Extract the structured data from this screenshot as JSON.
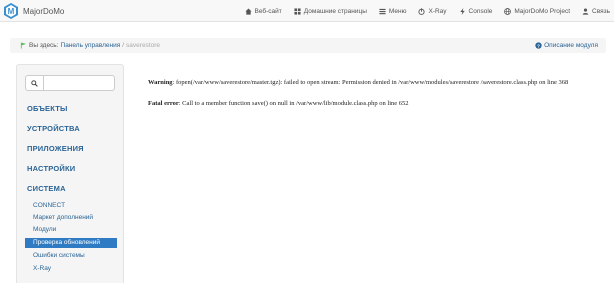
{
  "navbar": {
    "brand": "MajorDoMo",
    "items": [
      {
        "label": "Веб-сайт",
        "icon": "home-icon"
      },
      {
        "label": "Домашние страницы",
        "icon": "grid-icon"
      },
      {
        "label": "Меню",
        "icon": "list-icon"
      },
      {
        "label": "X-Ray",
        "icon": "power-icon"
      },
      {
        "label": "Console",
        "icon": "flash-icon"
      },
      {
        "label": "MajorDoMo Project",
        "icon": "globe-icon"
      },
      {
        "label": "Связь",
        "icon": "user-icon"
      }
    ]
  },
  "breadcrumb": {
    "home": "Вы здесь:",
    "link": "Панель управления",
    "separator": "/",
    "current": "saverestore",
    "help": "Описание модуля"
  },
  "sidebar": {
    "search_placeholder": "",
    "sections": [
      "ОБЪЕКТЫ",
      "УСТРОЙСТВА",
      "ПРИЛОЖЕНИЯ",
      "НАСТРОЙКИ",
      "СИСТЕМА"
    ],
    "sub_items": [
      {
        "label": "CONNECT",
        "active": false
      },
      {
        "label": "Маркет дополнений",
        "active": false
      },
      {
        "label": "Модули",
        "active": false
      },
      {
        "label": "Проверка обновлений",
        "active": true
      },
      {
        "label": "Ошибки системы",
        "active": false
      },
      {
        "label": "X-Ray",
        "active": false
      }
    ]
  },
  "content": {
    "warning_label": "Warning",
    "warning_text": ": fopen(/var/www/saverestore/master.tgz): failed to open stream: Permission denied in /var/www/modules/saverestore /saverestore.class.php on line 368",
    "fatal_label": "Fatal error",
    "fatal_text": ": Call to a member function save() on null in /var/www/lib/module.class.php on line 652"
  },
  "colors": {
    "link": "#2a6496",
    "active": "#2f7bc3",
    "logo": "#3a8fd0"
  }
}
